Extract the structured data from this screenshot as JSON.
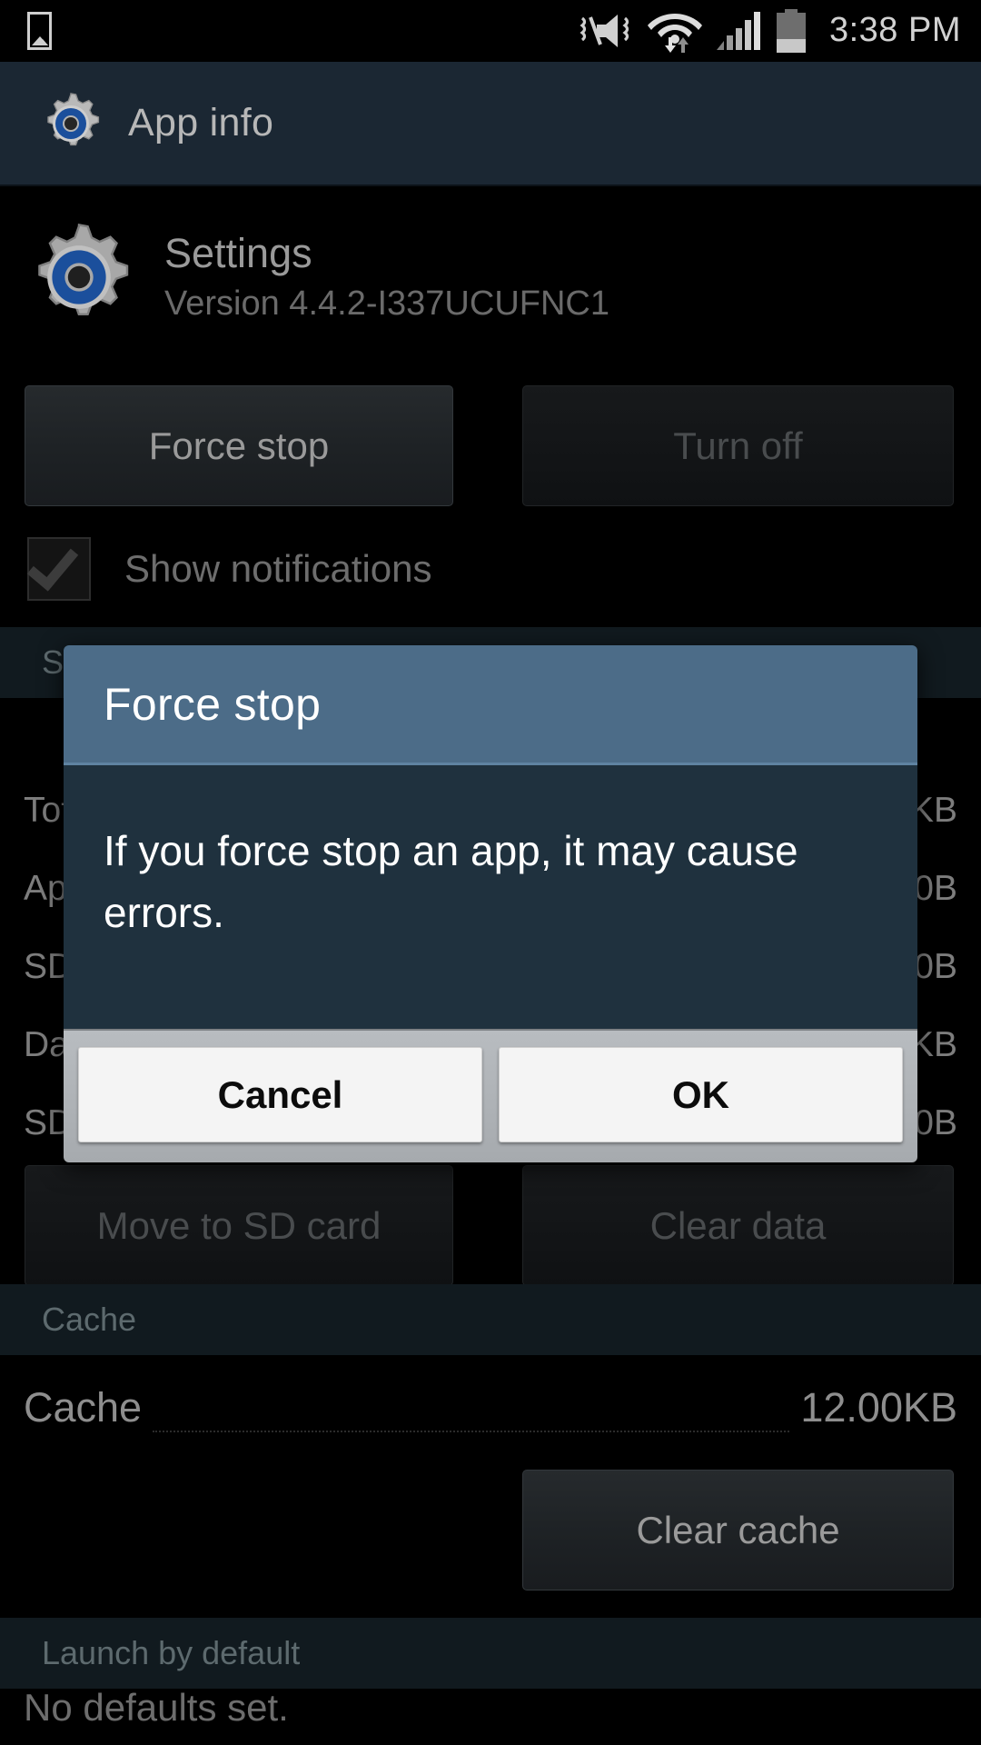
{
  "status_bar": {
    "time": "3:38 PM",
    "icons": [
      "screenshot-icon",
      "sound-mute-vibrate-icon",
      "wifi-icon",
      "cellular-signal-icon",
      "battery-icon"
    ]
  },
  "action_bar": {
    "title": "App info",
    "icon": "settings-gear-icon"
  },
  "app_header": {
    "icon": "settings-gear-icon",
    "name": "Settings",
    "version": "Version 4.4.2-I337UCUFNC1"
  },
  "controls": {
    "force_stop_label": "Force stop",
    "turn_off_label": "Turn off",
    "show_notifications_label": "Show notifications",
    "show_notifications_checked": true,
    "move_to_sd_label": "Move to SD card",
    "clear_data_label": "Clear data",
    "clear_cache_label": "Clear cache"
  },
  "storage": {
    "section_title": "Storage",
    "rows": [
      {
        "label": "Total",
        "value": "KB"
      },
      {
        "label": "App",
        "value": "0B"
      },
      {
        "label": "SD card app",
        "value": "0B"
      },
      {
        "label": "Data",
        "value": "KB"
      },
      {
        "label": "SD card data",
        "value": "0B"
      }
    ]
  },
  "cache": {
    "section_title": "Cache",
    "label": "Cache",
    "value": "12.00KB"
  },
  "launch_by_default": {
    "section_title": "Launch by default",
    "text": "No defaults set."
  },
  "dialog": {
    "title": "Force stop",
    "message": "If you force stop an app, it may cause errors.",
    "cancel_label": "Cancel",
    "ok_label": "OK",
    "title_color": "#4c6c88",
    "body_color": "#1f313e"
  }
}
